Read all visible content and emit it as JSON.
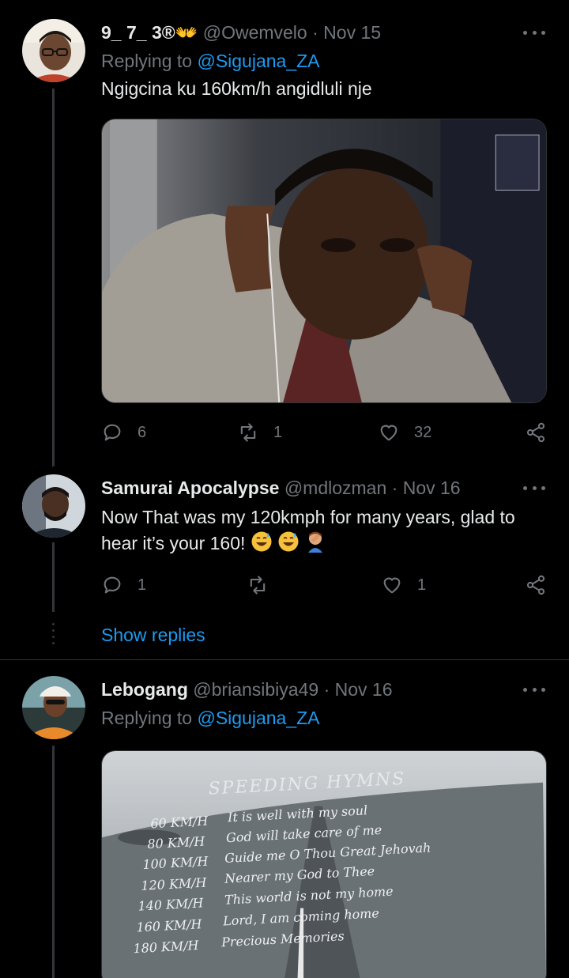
{
  "tweets": [
    {
      "display_name": "9_ 7_ 3®👐",
      "handle": "@Owemvelo",
      "date": "Nov 15",
      "reply_prefix": "Replying to ",
      "reply_to": "@Sigujana_ZA",
      "text": "Ngigcina ku 160km/h angidluli nje",
      "actions": {
        "replies": "6",
        "retweets": "1",
        "likes": "32"
      }
    },
    {
      "display_name": "Samurai Apocalypse",
      "handle": "@mdlozman",
      "date": "Nov 16",
      "text": "Now That was my 120kmph for many years, glad to hear it’s your 160!",
      "emojis": [
        "grinning-sweat",
        "grinning-sweat",
        "man-facepalming"
      ],
      "actions": {
        "replies": "1",
        "retweets": "",
        "likes": "1"
      },
      "show_replies": "Show replies"
    },
    {
      "display_name": "Lebogang",
      "handle": "@briansibiya49",
      "date": "Nov 16",
      "reply_prefix": "Replying to ",
      "reply_to": "@Sigujana_ZA",
      "image_text": {
        "title": "SPEEDING HYMNS",
        "rows": [
          {
            "speed": "60 KM/H",
            "hymn": "It is well with my soul"
          },
          {
            "speed": "80 KM/H",
            "hymn": "God will take care of me"
          },
          {
            "speed": "100 KM/H",
            "hymn": "Guide me O Thou Great Jehovah"
          },
          {
            "speed": "120 KM/H",
            "hymn": "Nearer my God to Thee"
          },
          {
            "speed": "140 KM/H",
            "hymn": "This world is not my home"
          },
          {
            "speed": "160 KM/H",
            "hymn": "Lord, I am coming home"
          },
          {
            "speed": "180 KM/H",
            "hymn": "Precious Memories"
          }
        ]
      }
    }
  ],
  "colors": {
    "background": "#000000",
    "text": "#e7e9ea",
    "muted": "#71767b",
    "accent": "#1d9bf0",
    "divider": "#2f3336"
  },
  "icons": [
    "reply-icon",
    "retweet-icon",
    "like-icon",
    "share-icon",
    "more-icon"
  ]
}
